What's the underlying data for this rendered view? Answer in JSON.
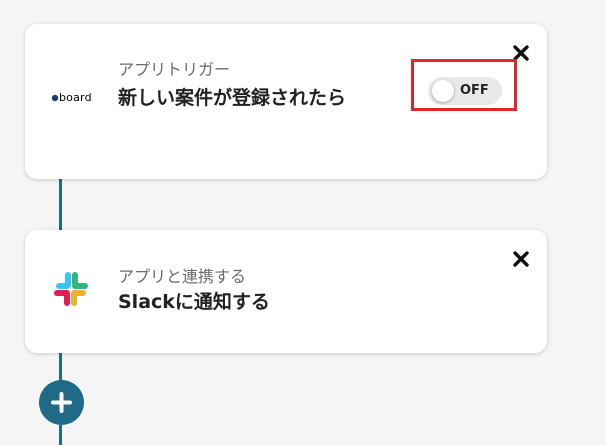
{
  "trigger_card": {
    "app_logo_text": "board",
    "subtitle": "アプリトリガー",
    "title": "新しい案件が登録されたら",
    "toggle_label": "OFF"
  },
  "action_card": {
    "app_icon": "slack-icon",
    "subtitle": "アプリと連携する",
    "title": "Slackに通知する"
  },
  "colors": {
    "accent": "#1f6a86",
    "highlight": "#e0262b"
  },
  "icons": {
    "close": "close-icon",
    "add": "plus-icon"
  }
}
